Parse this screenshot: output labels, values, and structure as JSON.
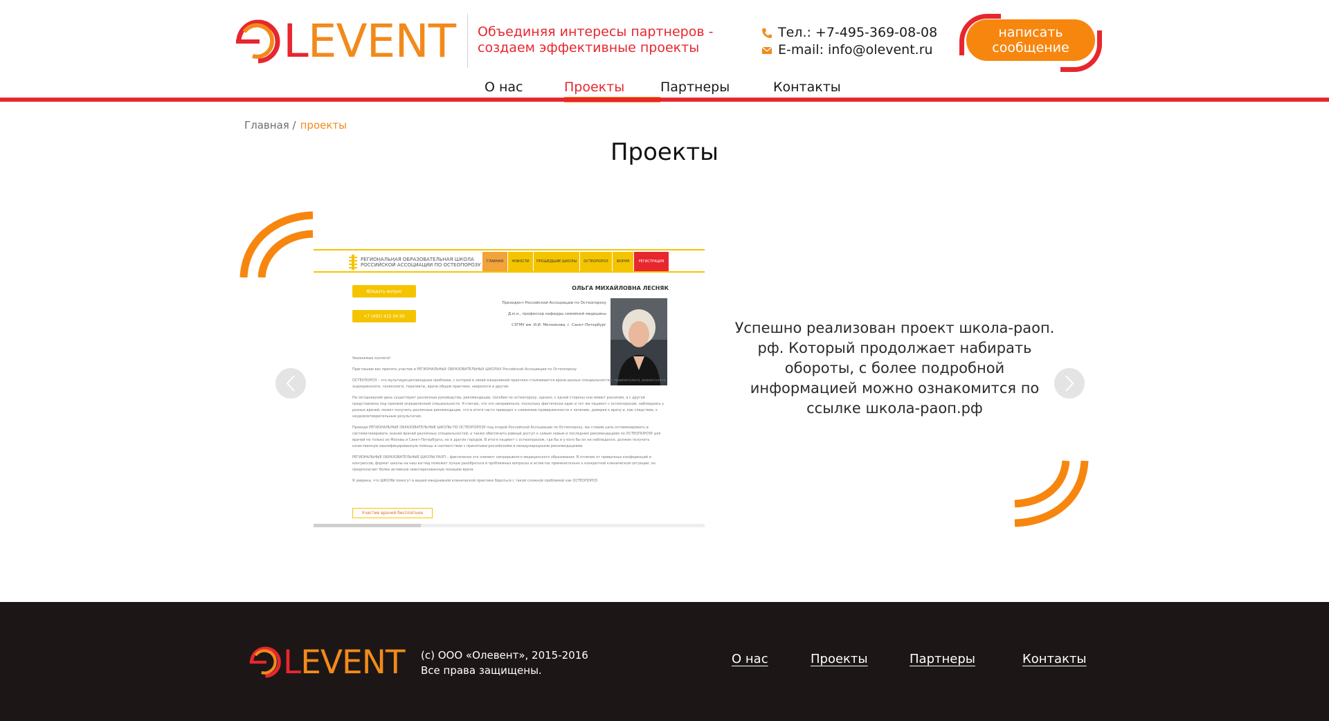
{
  "brand": {
    "logo_letter_1": "L",
    "logo_letters_rest": "EVENT",
    "red": "#e8262e",
    "orange": "#f7860f"
  },
  "header": {
    "slogan_line_1": "Объединяя интересы партнеров -",
    "slogan_line_2": "создаем эффективные проекты",
    "phone": "Тел.: +7-495-369-08-08",
    "email": "E-mail: info@olevent.ru",
    "write_button_line_1": "написать",
    "write_button_line_2": "сообщение",
    "phone_icon": "phone-icon",
    "email_icon": "envelope-icon"
  },
  "nav": {
    "items": [
      {
        "label": "О нас",
        "active": false
      },
      {
        "label": "Проекты",
        "active": true
      },
      {
        "label": "Партнеры",
        "active": false
      },
      {
        "label": "Контакты",
        "active": false
      }
    ]
  },
  "breadcrumb": {
    "home": "Главная /",
    "current": "проекты"
  },
  "page": {
    "title": "Проекты"
  },
  "slider": {
    "prev_icon": "chevron-left-icon",
    "next_icon": "chevron-right-icon",
    "text": "Успешно реализован проект школа-раоп. рф. Который продолжает набирать обороты, с более подробной информацией можно ознакомится по ссылке школа-раоп.рф",
    "screenshot": {
      "logo_line_1": "РЕГИОНАЛЬНАЯ ОБРАЗОВАТЕЛЬНАЯ ШКОЛА",
      "logo_line_2": "РОССИЙСКОЙ АССОЦИАЦИИ ПО ОСТЕОПОРОЗУ",
      "nav": [
        "ГЛАВНАЯ",
        "НОВОСТИ",
        "ПРОШЕДШИЕ ШКОЛЫ",
        "ОСТЕОПОРОЗ",
        "ФОРУМ",
        "РЕГИСТРАЦИЯ"
      ],
      "ask_button": "✪Задать вопрос",
      "phone_button": "+7 (495) 415 04 90",
      "name": "ОЛЬГА МИХАЙЛОВНА ЛЕСНЯК",
      "bio_1": "Президент Российской Ассоциации по Остеопорозу",
      "bio_2": "Д.м.н., профессор кафедры семейной медицины",
      "bio_3": "СЗГМУ им. И.И. Мечникова, г. Санкт-Петербург",
      "para_1": "Уважаемые коллеги!",
      "para_2": "Приглашаю вас принять участие в РЕГИОНАЛЬНЫХ ОБРАЗОВАТЕЛЬНЫХ ШКОЛАХ Российской Ассоциации по Остеопорозу",
      "para_3": "ОСТЕОПОРОЗ – это мультидисциплинарная проблема, с которой в своей ежедневной практике сталкиваются врачи разных специальностей: травматологи, ревматологи, эндокринологи, гинекологи, терапевты, врачи общей практики, неврологи и другие.",
      "para_4": "На сегодняшний день существуют различные руководства, рекомендации, пособия по остеопорозу, однако, с одной стороны они имеют различия, а с другой представлены под призмой определенной специальности. Я считаю, что это неправильно, поскольку фактически один и тот же пациент с остеопорозом, наблюдаясь у разных врачей, может получить различные рекомендации, что в итоге часто приводит к снижению приверженности к лечению, доверия к врачу и, как следствие, к неудовлетворительным результатам.",
      "para_5": "Проводя РЕГИОНАЛЬНЫЕ ОБРАЗОВАТЕЛЬНЫЕ ШКОЛЫ ПО ОСТЕОПОРОЗУ под эгидой Российской Ассоциации по Остеопорозу, мы ставим цель оптимизировать и систематизировать знания врачей различных специальностей, а также обеспечить равный доступ к самым новым и последним рекомендациям по ОСТЕОПОРОЗУ для врачей не только из Москвы и Санкт-Петербурга, но и других городов. В итоге пациент с остеопорозом, где бы и у кого бы он ни наблюдался, должен получить качественную квалифицированную помощь в соответствии с принятыми российскими и международными рекомендациями.",
      "para_6": "РЕГИОНАЛЬНЫЕ ОБРАЗОВАТЕЛЬНЫЕ ШКОЛЫ РАОП – фактически это элемент непрерывного медицинского образования. В отличие от привычных конференций и конгрессов, формат школы на наш взгляд поможет лучше разобраться в проблемных вопросах и аспектах применительно к конкретной клинической ситуации, он предполагает более активную заинтересованную позицию врача.",
      "para_7": "Я уверена, что ШКОЛЫ помогут в вашей ежедневной клинической практике бороться с такой сложной проблемой как ОСТЕОПОРОЗ",
      "free_badge": "Участие врачей бесплатное"
    }
  },
  "footer": {
    "copyright_1": "(с) ООО «Олевент», 2015-2016",
    "copyright_2": "Все права защищены.",
    "links": [
      "О нас",
      "Проекты",
      "Партнеры",
      "Контакты"
    ]
  }
}
